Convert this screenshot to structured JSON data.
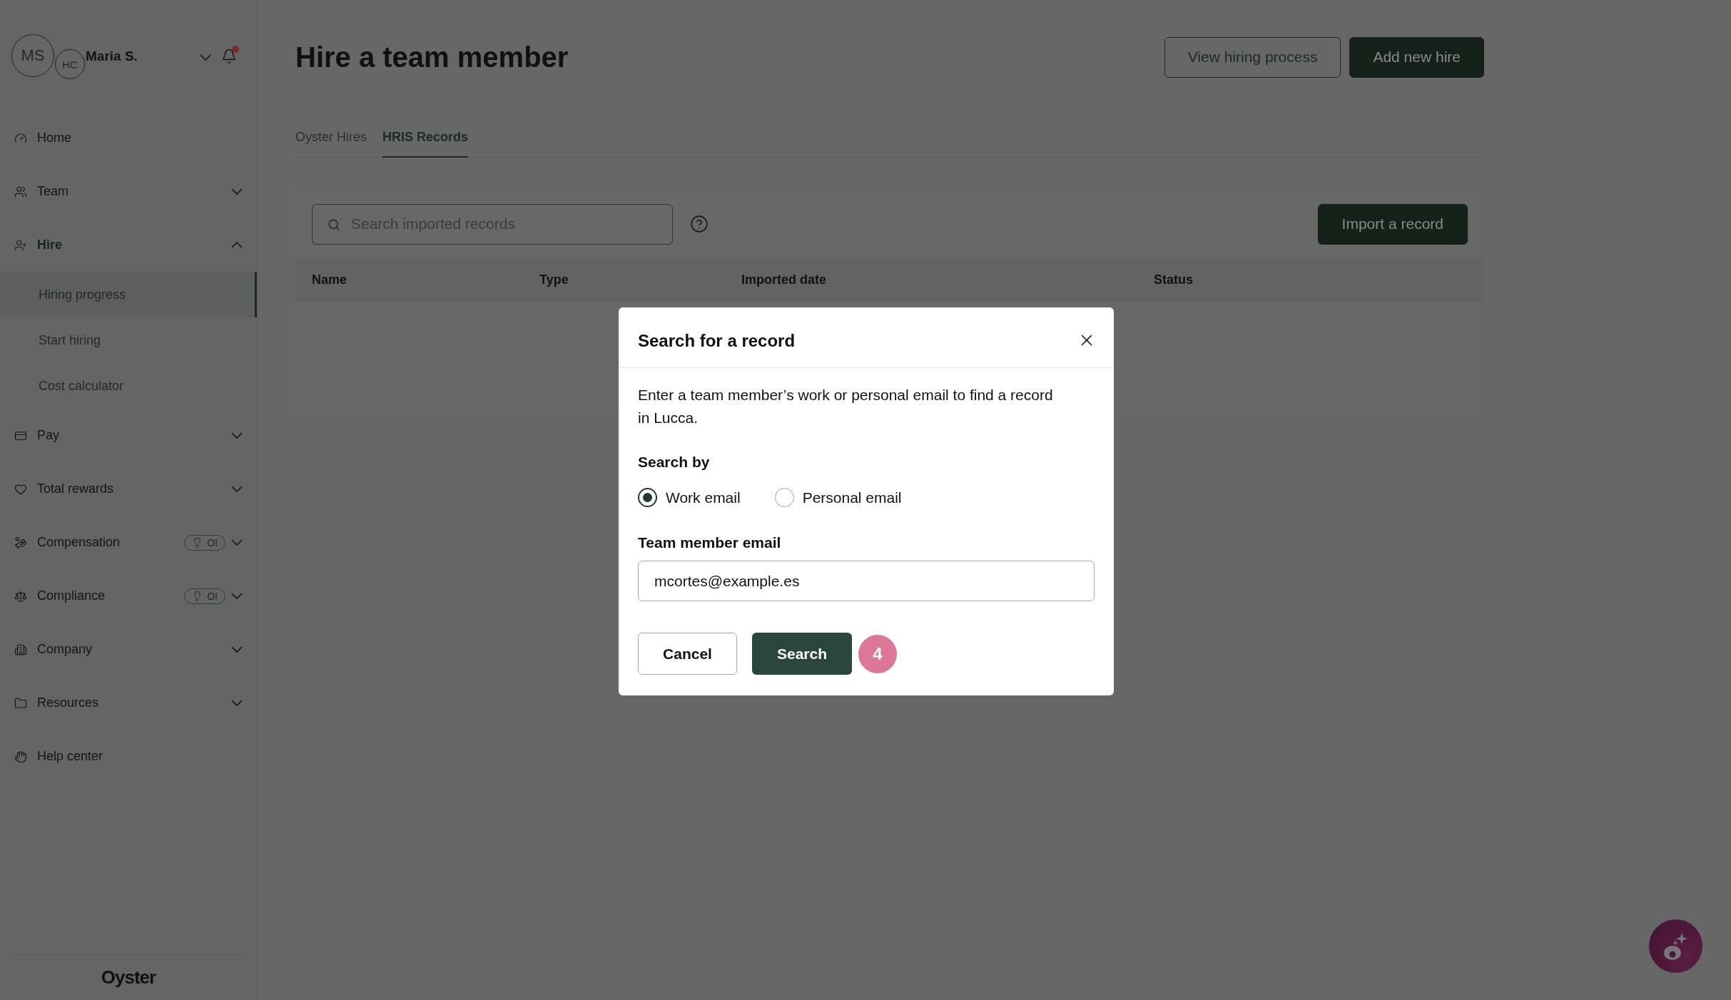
{
  "user": {
    "initials": "MS",
    "company_initials": "HC",
    "name": "Maria S.",
    "has_notification": true
  },
  "nav": [
    {
      "kind": "link",
      "label": "Home"
    },
    {
      "kind": "group",
      "label": "Team",
      "expanded": false
    },
    {
      "kind": "group",
      "label": "Hire",
      "expanded": true,
      "children": [
        {
          "label": "Hiring progress",
          "selected": true
        },
        {
          "label": "Start hiring",
          "selected": false
        },
        {
          "label": "Cost calculator",
          "selected": false
        }
      ]
    },
    {
      "kind": "group",
      "label": "Pay",
      "expanded": false
    },
    {
      "kind": "group",
      "label": "Total rewards",
      "expanded": false
    },
    {
      "kind": "group",
      "label": "Compensation",
      "expanded": false,
      "badge": "OI"
    },
    {
      "kind": "group",
      "label": "Compliance",
      "expanded": false,
      "badge": "OI"
    },
    {
      "kind": "group",
      "label": "Company",
      "expanded": false
    },
    {
      "kind": "group",
      "label": "Resources",
      "expanded": false
    },
    {
      "kind": "link",
      "label": "Help center"
    }
  ],
  "logo": "Oyster",
  "page": {
    "title": "Hire a team member",
    "buttons": [
      {
        "label": "View hiring process",
        "kind": "outline"
      },
      {
        "label": "Add new hire",
        "kind": "primary"
      }
    ]
  },
  "tabs": [
    {
      "label": "Oyster Hires",
      "selected": false
    },
    {
      "label": "HRIS Records",
      "selected": true
    }
  ],
  "records": {
    "search": {
      "placeholder": "Search imported records"
    },
    "import_button": "Import a record",
    "columns": [
      "Name",
      "Type",
      "Imported date",
      "Status"
    ]
  },
  "dialog": {
    "title": "Search for a record",
    "description": "Enter a team member’s work or personal email to find a record in Lucca.",
    "search_by_label": "Search by",
    "options": [
      {
        "label": "Work email",
        "selected": true
      },
      {
        "label": "Personal email",
        "selected": false
      }
    ],
    "email_label": "Team member email",
    "email_value": "mcortes@example.es",
    "cancel": "Cancel",
    "submit": "Search",
    "step_badge": "4"
  }
}
